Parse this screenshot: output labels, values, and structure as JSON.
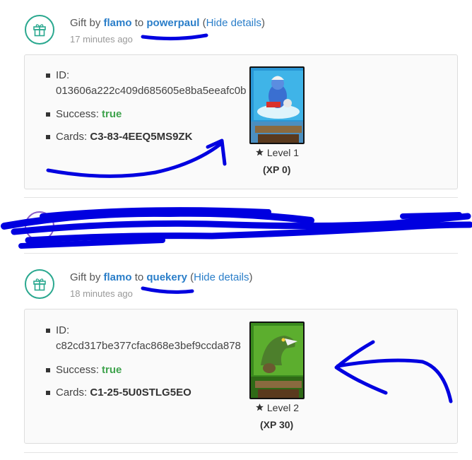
{
  "entries": [
    {
      "prefix": "Gift by ",
      "from": "flamo",
      "to_word": " to ",
      "to": "powerpaul",
      "hide_open": " (",
      "hide": "Hide details",
      "hide_close": ")",
      "time": "17 minutes ago",
      "id_label": "ID:",
      "id": "013606a222c409d685605e8ba5eeafc0b",
      "success_label": "Success:",
      "success": "true",
      "cards_label": "Cards:",
      "cards": "C3-83-4EEQ5MS9ZK",
      "level": "Level 1",
      "xp": "(XP 0)"
    },
    {
      "prefix": "Gift by ",
      "from": "flamo",
      "to_word": " to ",
      "to": "quekery",
      "hide_open": " (",
      "hide": "Hide details",
      "hide_close": ")",
      "time": "18 minutes ago",
      "id_label": "ID:",
      "id": "c82cd317be377cfac868e3bef9ccda878",
      "success_label": "Success:",
      "success": "true",
      "cards_label": "Cards:",
      "cards": "C1-25-5U0STLG5EO",
      "level": "Level 2",
      "xp": "(XP 30)"
    }
  ],
  "icons": {
    "gift": "gift-icon",
    "star": "star-icon"
  },
  "colors": {
    "accent": "#2aa88f",
    "link": "#2a7ec9",
    "success": "#3fa34d",
    "scribble": "#0000e0"
  }
}
